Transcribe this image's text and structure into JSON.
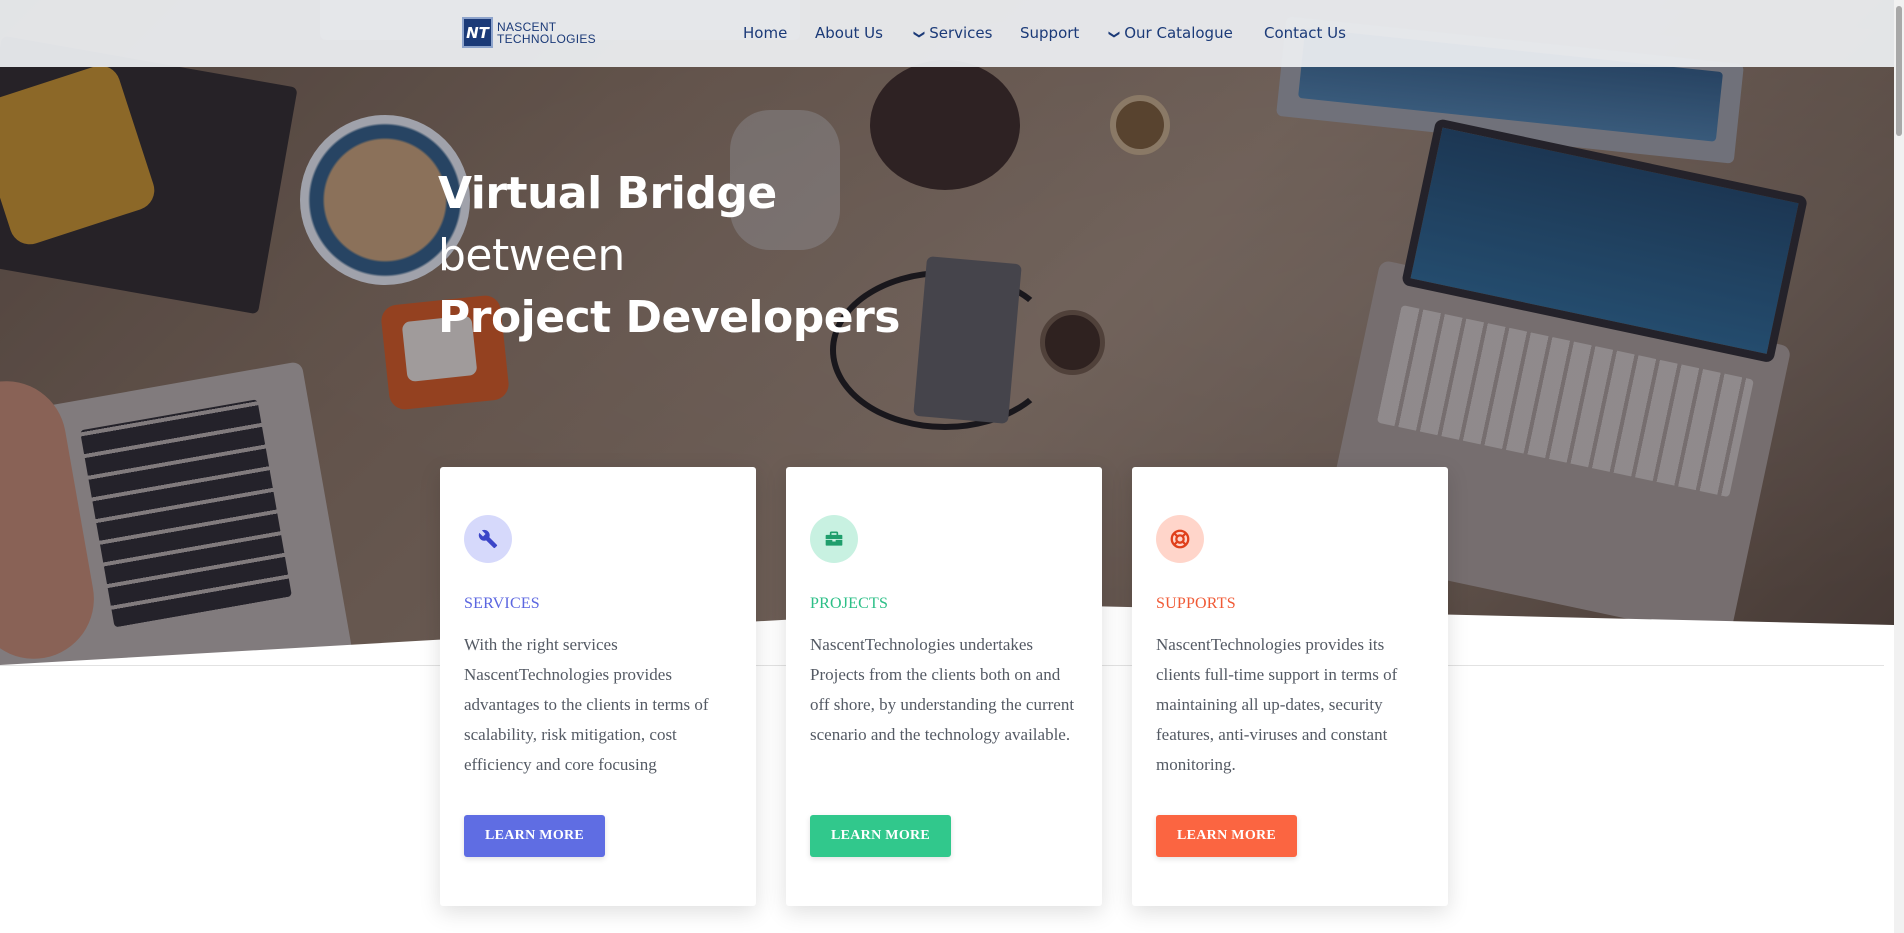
{
  "navbar": {
    "brand_line1": "NASCENT",
    "brand_line2": "TECHNOLOGIES",
    "brand_logo_text": "NT",
    "items": [
      {
        "label": "Home",
        "has_chevron": false
      },
      {
        "label": "About Us",
        "has_chevron": false
      },
      {
        "label": "Services",
        "has_chevron": true,
        "icon": "chevron-down-icon"
      },
      {
        "label": "Support",
        "has_chevron": false
      },
      {
        "label": "Our Catalogue",
        "has_chevron": true,
        "icon": "chevron-down-icon"
      },
      {
        "label": "Contact Us",
        "has_chevron": false
      }
    ]
  },
  "hero": {
    "line1": "Virtual Bridge",
    "line2": "between",
    "line3": "Project Developers"
  },
  "cards": [
    {
      "icon": "wrench-icon",
      "title": "SERVICES",
      "text": "With the right services NascentTechnologies provides advantages to the clients in terms of scalability, risk mitigation, cost efficiency and core focusing",
      "button": "LEARN MORE",
      "accent": "#5f6de3"
    },
    {
      "icon": "briefcase-icon",
      "title": "PROJECTS",
      "text": "NascentTechnologies undertakes Projects from the clients both on and off shore, by understanding the current scenario and the technology available.",
      "button": "LEARN MORE",
      "accent": "#31c88c"
    },
    {
      "icon": "life-ring-icon",
      "title": "SUPPORTS",
      "text": "NascentTechnologies provides its clients full-time support in terms of maintaining all up-dates, security features, anti-viruses and constant monitoring.",
      "button": "LEARN MORE",
      "accent": "#fb6541"
    }
  ],
  "colors": {
    "brand": "#1b3a78",
    "navbar_bg": "#eceef1"
  }
}
